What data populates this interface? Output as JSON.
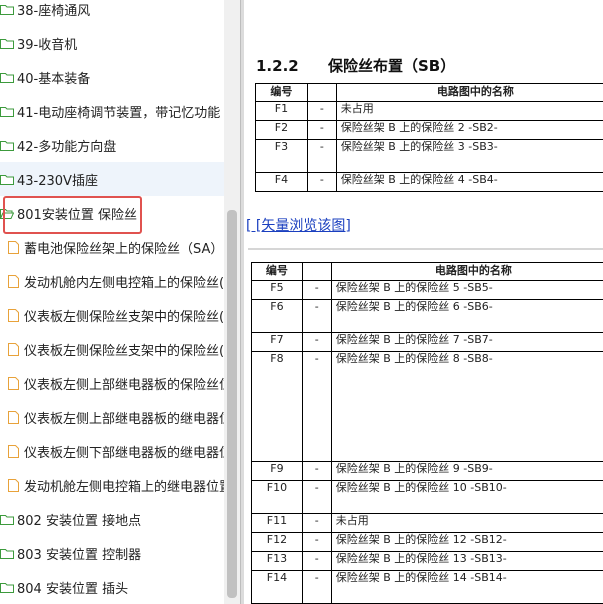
{
  "sidebar": {
    "items": [
      {
        "label": "38-座椅通风",
        "type": "folder"
      },
      {
        "label": "39-收音机",
        "type": "folder"
      },
      {
        "label": "40-基本装备",
        "type": "folder"
      },
      {
        "label": "41-电动座椅调节装置，带记忆功能",
        "type": "folder"
      },
      {
        "label": "42-多功能方向盘",
        "type": "folder"
      },
      {
        "label": "43-230V插座",
        "type": "folder"
      },
      {
        "label": "801安装位置 保险丝",
        "type": "folder-open"
      },
      {
        "label": "蓄电池保险丝架上的保险丝（SA）",
        "type": "page"
      },
      {
        "label": "发动机舱内左侧电控箱上的保险丝(",
        "type": "page"
      },
      {
        "label": "仪表板左侧保险丝支架中的保险丝(S",
        "type": "page"
      },
      {
        "label": "仪表板左侧保险丝支架中的保险丝(S",
        "type": "page"
      },
      {
        "label": "仪表板左侧上部继电器板的保险丝位",
        "type": "page"
      },
      {
        "label": "仪表板左侧上部继电器板的继电器位",
        "type": "page"
      },
      {
        "label": "仪表板左侧下部继电器板的继电器位",
        "type": "page"
      },
      {
        "label": "发动机舱左侧电控箱上的继电器位置",
        "type": "page"
      },
      {
        "label": "802 安装位置 接地点",
        "type": "folder"
      },
      {
        "label": "803 安装位置 控制器",
        "type": "folder"
      },
      {
        "label": "804 安装位置 插头",
        "type": "folder"
      }
    ]
  },
  "content": {
    "section_number": "1.2.2",
    "section_title": "保险丝布置（SB）",
    "table1": {
      "headers": [
        "编号",
        "",
        "电路图中的名称"
      ],
      "rows": [
        {
          "id": "F1",
          "dash": "-",
          "name": "未占用"
        },
        {
          "id": "F2",
          "dash": "-",
          "name": "保险丝架 B 上的保险丝 2 -SB2-"
        },
        {
          "id": "F3",
          "dash": "-",
          "name": "保险丝架 B 上的保险丝 3 -SB3-"
        },
        {
          "id": "F4",
          "dash": "-",
          "name": "保险丝架 B 上的保险丝 4 -SB4-"
        }
      ]
    },
    "vector_link": "[ [矢量浏览该图]",
    "table2": {
      "headers": [
        "编号",
        "",
        "电路图中的名称"
      ],
      "rows": [
        {
          "id": "F5",
          "dash": "-",
          "name": "保险丝架 B 上的保险丝 5 -SB5-"
        },
        {
          "id": "F6",
          "dash": "-",
          "name": "保险丝架 B 上的保险丝 6 -SB6-"
        },
        {
          "id": "F7",
          "dash": "-",
          "name": "保险丝架 B 上的保险丝 7 -SB7-"
        },
        {
          "id": "F8",
          "dash": "-",
          "name": "保险丝架 B 上的保险丝 8 -SB8-"
        },
        {
          "id": "F9",
          "dash": "-",
          "name": "保险丝架 B 上的保险丝 9 -SB9-"
        },
        {
          "id": "F10",
          "dash": "-",
          "name": "保险丝架 B 上的保险丝 10 -SB10-"
        },
        {
          "id": "F11",
          "dash": "-",
          "name": "未占用"
        },
        {
          "id": "F12",
          "dash": "-",
          "name": "保险丝架 B 上的保险丝 12 -SB12-"
        },
        {
          "id": "F13",
          "dash": "-",
          "name": "保险丝架 B 上的保险丝 13 -SB13-"
        },
        {
          "id": "F14",
          "dash": "-",
          "name": "保险丝架 B 上的保险丝 14 -SB14-"
        }
      ]
    }
  },
  "colors": {
    "folder": "#3c9a3c",
    "page": "#e8a23a",
    "highlight": "#e0524f",
    "link": "#1a3fbf"
  }
}
